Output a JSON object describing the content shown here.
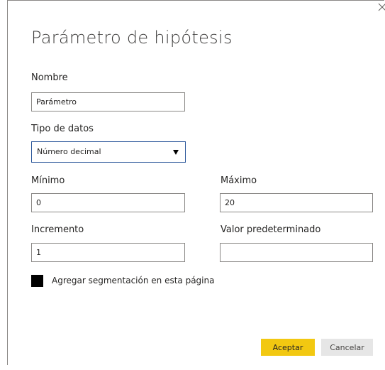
{
  "dialog": {
    "title": "Parámetro de hipótesis",
    "close_icon": "close-icon"
  },
  "fields": {
    "nombre": {
      "label": "Nombre",
      "value": "Parámetro"
    },
    "tipo_datos": {
      "label": "Tipo de datos",
      "value": "Número decimal"
    },
    "minimo": {
      "label": "Mínimo",
      "value": "0"
    },
    "maximo": {
      "label": "Máximo",
      "value": "20"
    },
    "incremento": {
      "label": "Incremento",
      "value": "1"
    },
    "valor_predeterminado": {
      "label": "Valor predeterminado",
      "value": ""
    }
  },
  "checkbox": {
    "label": "Agregar segmentación en esta página",
    "checked": true
  },
  "buttons": {
    "accept": "Aceptar",
    "cancel": "Cancelar"
  },
  "colors": {
    "accent": "#f2c811",
    "select_border": "#2b579a",
    "input_border": "#8a8886"
  }
}
